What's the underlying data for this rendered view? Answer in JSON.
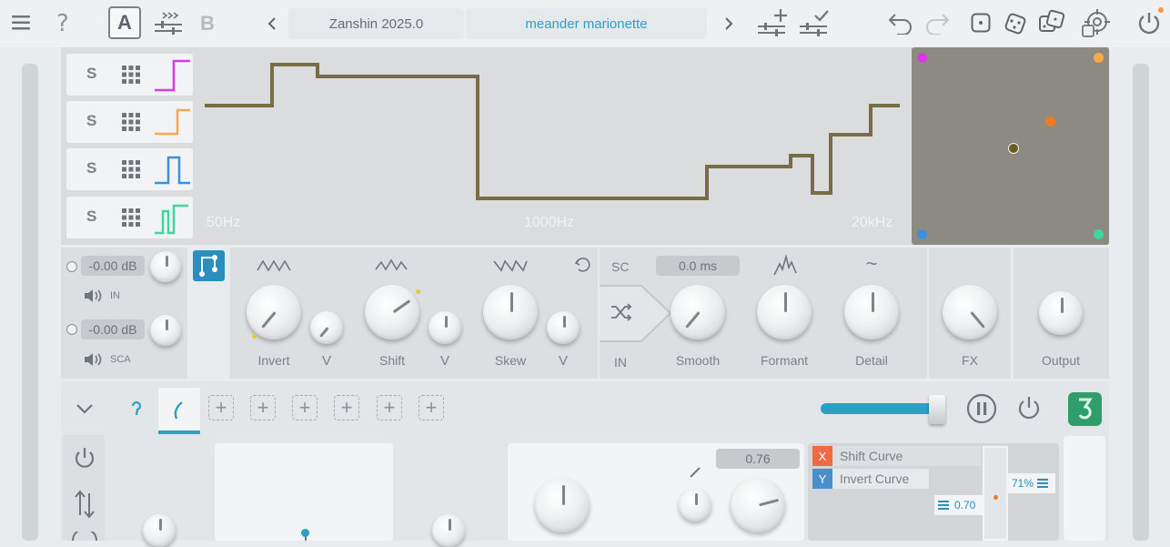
{
  "header": {
    "ab_active": "A",
    "ab_inactive": "B",
    "preset_bank": "Zanshin 2025.0",
    "preset_name": "meander marionette"
  },
  "eq": {
    "bands": [
      {
        "label": "S",
        "color": "#d63ce6"
      },
      {
        "label": "S",
        "color": "#f7a84a"
      },
      {
        "label": "S",
        "color": "#3f8fd8"
      },
      {
        "label": "S",
        "color": "#3ed7a0"
      }
    ],
    "freq_labels": [
      "50Hz",
      "1000Hz",
      "20kHz"
    ],
    "curve_color": "#776c45",
    "xy_dots": [
      {
        "color": "#d63ce6"
      },
      {
        "color": "#f7a84a"
      },
      {
        "color": "#3f8fd8"
      },
      {
        "color": "#3ed7a0"
      },
      {
        "color": "#f07a22"
      }
    ]
  },
  "inputs": {
    "in_level": "-0.00 dB",
    "in_label": "IN",
    "sca_level": "-0.00 dB",
    "sca_label": "SCA"
  },
  "morph": {
    "invert_label": "Invert",
    "shift_label": "Shift",
    "skew_label": "Skew",
    "sub_glyph": "V"
  },
  "sidechain": {
    "sc_label": "SC",
    "time": "0.0 ms",
    "in_label": "IN",
    "smooth_label": "Smooth",
    "formant_label": "Formant",
    "detail_label": "Detail",
    "detail_glyph": "~"
  },
  "fx_label": "FX",
  "output_label": "Output",
  "bottom": {
    "tab_plus": [
      "+",
      "+",
      "+",
      "+",
      "+",
      "+"
    ],
    "value_box": "0.76",
    "curves": [
      {
        "tag": "X",
        "label": "Shift Curve",
        "color": "#ee6a45"
      },
      {
        "tag": "Y",
        "label": "Invert Curve",
        "color": "#4a8fc9"
      }
    ],
    "fader_left": "0.70",
    "fader_right": "71%"
  },
  "accent": "#2aa0c4"
}
